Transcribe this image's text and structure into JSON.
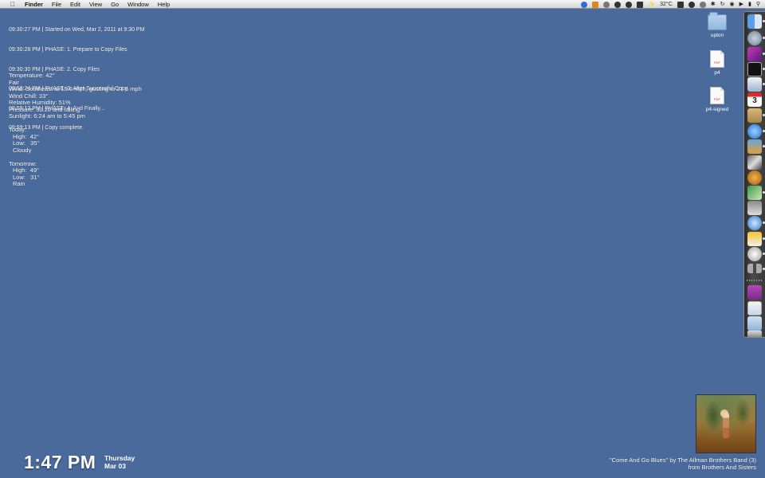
{
  "menubar": {
    "apple_icon": "apple-icon",
    "items": [
      "Finder",
      "File",
      "Edit",
      "View",
      "Go",
      "Window",
      "Help"
    ],
    "extras": {
      "temperature": "32°C"
    }
  },
  "log": [
    "09:30:27 PM | Started on Wed, Mar 2, 2011 at 9:30 PM",
    "09:30:28 PM | PHASE: 1. Prepare to Copy Files",
    "09:30:30 PM | PHASE: 2. Copy Files",
    "09:58:24 PM | PHASE: 3. After Successful Copy",
    "09:59:13 PM | PHASE: 4. And Finally...",
    "09:59:13 PM | Copy complete."
  ],
  "weather": {
    "temperature": "Temperature: 42°",
    "condition": "Fair",
    "wind": "Wind: Southeast at 19.6 mph, gusting to 27.6 mph",
    "wind_chill": "Wind Chill: 33°",
    "humidity": "Relative Humidity: 51%",
    "pressure": "Pressure: 30.20 and falling",
    "sunlight": "Sunlight: 6:24 am to 5:45 pm",
    "today_label": "Today:",
    "today_high": "High:  42°",
    "today_low": "Low:   35°",
    "today_cond": "Cloudy",
    "tomorrow_label": "Tomorrow:",
    "tomorrow_high": "High:  49°",
    "tomorrow_low": "Low:   31°",
    "tomorrow_cond": "Rain"
  },
  "desktop_icons": [
    {
      "label": "upton",
      "kind": "folder-icon"
    },
    {
      "label": "p4",
      "kind": "document-icon"
    },
    {
      "label": "p4-signed",
      "kind": "document-icon"
    }
  ],
  "dock": {
    "items": [
      "finder-icon",
      "system-preferences-icon",
      "photo-app-icon",
      "terminal-icon",
      "text-editor-icon",
      "calendar-icon",
      "notes-icon",
      "itunes-icon",
      "iphoto-icon",
      "utility-icon",
      "acorn-icon",
      "photo-viewer-icon",
      "screen-sharing-icon",
      "safari-icon",
      "transmit-icon",
      "diagnostics-icon",
      "glasses-icon",
      "app-folder-icon",
      "documents-icon",
      "folder-icon",
      "trash-icon"
    ],
    "calendar_day": "3"
  },
  "clock": {
    "time": "1:47 PM",
    "weekday": "Thursday",
    "date": "Mar 03"
  },
  "now_playing": {
    "line1": "\"Come And Go Blues\" by The Allman Brothers Band (3)",
    "line2": "from Brothers And Sisters"
  },
  "colors": {
    "desktop": "#4a6a9c"
  }
}
